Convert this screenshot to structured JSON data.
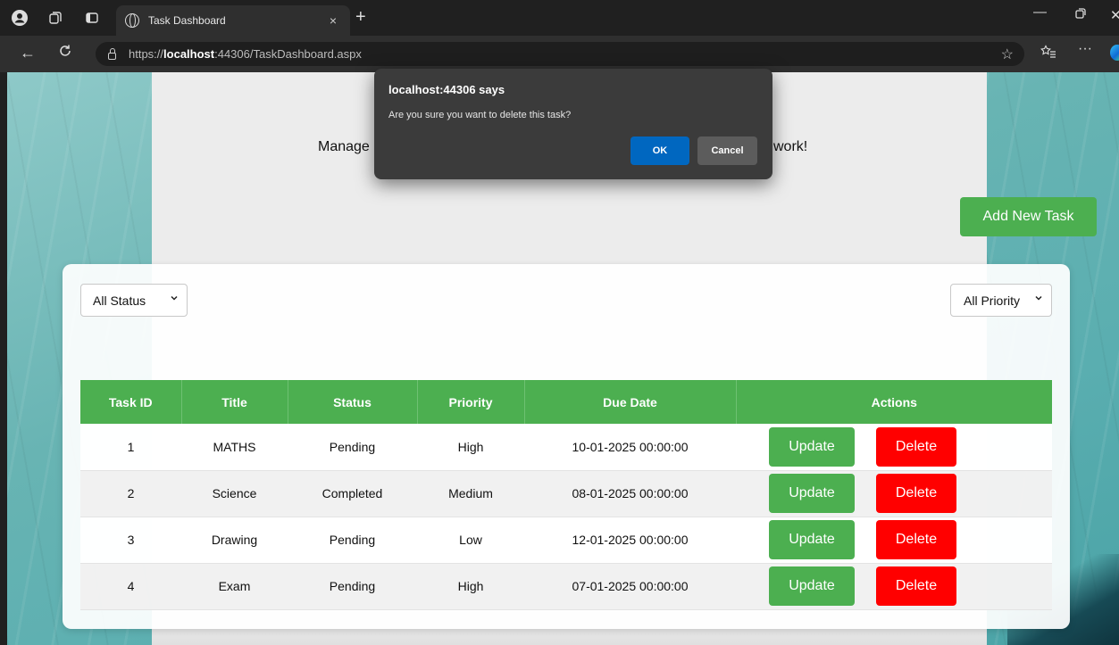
{
  "browser": {
    "tab_title": "Task Dashboard",
    "tab_close": "×",
    "new_tab": "+",
    "url_prefix": "https://",
    "url_host": "localhost",
    "url_rest": ":44306/TaskDashboard.aspx"
  },
  "page": {
    "header_left": "Manage",
    "header_right": "work!",
    "add_button": "Add New Task",
    "filters": {
      "status_value": "All Status",
      "priority_value": "All Priority"
    },
    "table": {
      "headers": [
        "Task ID",
        "Title",
        "Status",
        "Priority",
        "Due Date",
        "Actions"
      ],
      "rows": [
        {
          "id": "1",
          "title": "MATHS",
          "status": "Pending",
          "priority": "High",
          "due": "10-01-2025 00:00:00"
        },
        {
          "id": "2",
          "title": "Science",
          "status": "Completed",
          "priority": "Medium",
          "due": "08-01-2025 00:00:00"
        },
        {
          "id": "3",
          "title": "Drawing",
          "status": "Pending",
          "priority": "Low",
          "due": "12-01-2025 00:00:00"
        },
        {
          "id": "4",
          "title": "Exam",
          "status": "Pending",
          "priority": "High",
          "due": "07-01-2025 00:00:00"
        }
      ],
      "update_label": "Update",
      "delete_label": "Delete"
    }
  },
  "dialog": {
    "title": "localhost:44306 says",
    "message": "Are you sure you want to delete this task?",
    "ok": "OK",
    "cancel": "Cancel"
  },
  "colors": {
    "green": "#4caf50",
    "red": "#ff0000",
    "dialog_ok": "#0067c0"
  }
}
